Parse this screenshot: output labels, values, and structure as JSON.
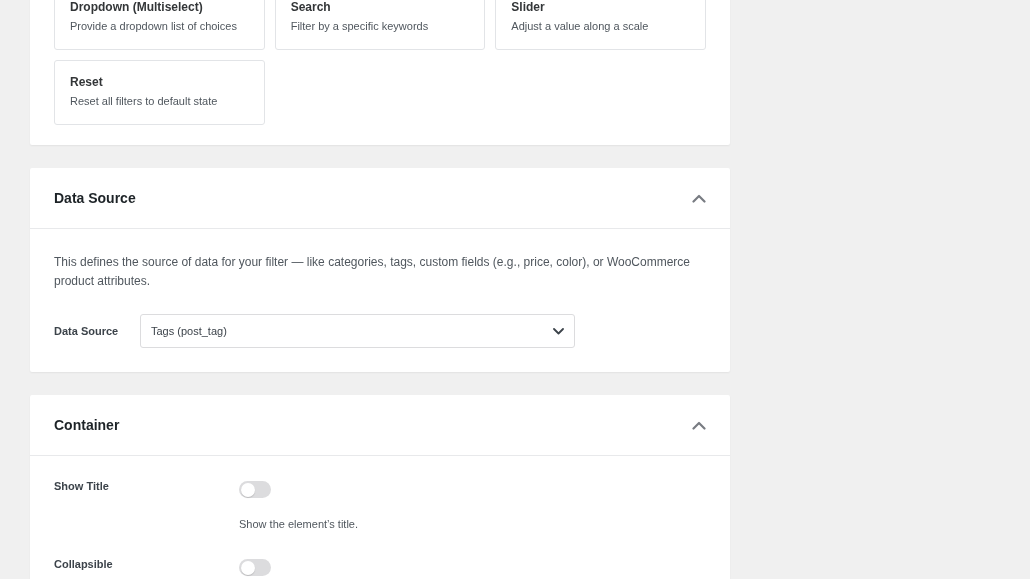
{
  "filter_types": {
    "cards": [
      {
        "title": "Dropdown (Multiselect)",
        "description": "Provide a dropdown list of choices"
      },
      {
        "title": "Search",
        "description": "Filter by a specific keywords"
      },
      {
        "title": "Slider",
        "description": "Adjust a value along a scale"
      },
      {
        "title": "Reset",
        "description": "Reset all filters to default state"
      }
    ]
  },
  "sections": [
    {
      "kind": "data_source",
      "title": "Data Source",
      "expanded": true,
      "description": "This defines the source of data for your filter — like categories, tags, custom fields (e.g., price, color), or WooCommerce product attributes.",
      "field": {
        "label": "Data Source",
        "value": "Tags (post_tag)"
      }
    },
    {
      "kind": "settings",
      "title": "Container",
      "expanded": true,
      "settings": [
        {
          "label": "Show Title",
          "on": false,
          "help": "Show the element’s title."
        },
        {
          "label": "Collapsible",
          "on": false
        }
      ]
    }
  ]
}
